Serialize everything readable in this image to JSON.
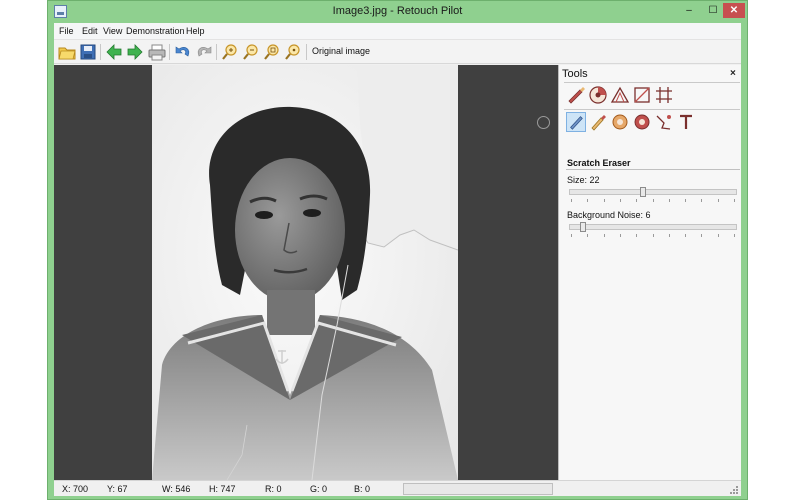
{
  "window": {
    "title": "Image3.jpg - Retouch Pilot",
    "accent_color": "#8fd08f",
    "controls": [
      "minimize-icon",
      "maximize-icon",
      "close-icon"
    ]
  },
  "menu": {
    "items": [
      "File",
      "Edit",
      "View",
      "Demonstration",
      "Help"
    ]
  },
  "toolbar": {
    "buttons": [
      "open-folder-icon",
      "save-icon",
      "back-arrow-icon",
      "forward-arrow-icon",
      "print-icon",
      "undo-icon",
      "redo-icon",
      "zoom-in-icon",
      "zoom-out-icon",
      "zoom-fit-icon",
      "zoom-actual-icon"
    ],
    "original_image_label": "Original image"
  },
  "canvas": {
    "image_description_icon": "photo-portrait-icon",
    "background_color": "#404040"
  },
  "tools": {
    "title": "Tools",
    "close_glyph": "×",
    "row1_icons": [
      "retouch-brush-icon",
      "color-wheel-icon",
      "perspective-icon",
      "crop-icon",
      "grid-icon"
    ],
    "row2_icons": [
      "scratch-eraser-icon",
      "healing-brush-icon",
      "stamp-icon",
      "patch-icon",
      "wand-icon",
      "text-icon"
    ],
    "active_tool": "Scratch Eraser",
    "params": {
      "size_label": "Size: 22",
      "size_value": 22,
      "size_max": 50,
      "noise_label": "Background Noise: 6",
      "noise_value": 6,
      "noise_max": 100
    }
  },
  "status": {
    "x": "X: 700",
    "y": "Y: 67",
    "w": "W: 546",
    "h": "H: 747",
    "r": "R: 0",
    "g": "G: 0",
    "b": "B: 0"
  }
}
